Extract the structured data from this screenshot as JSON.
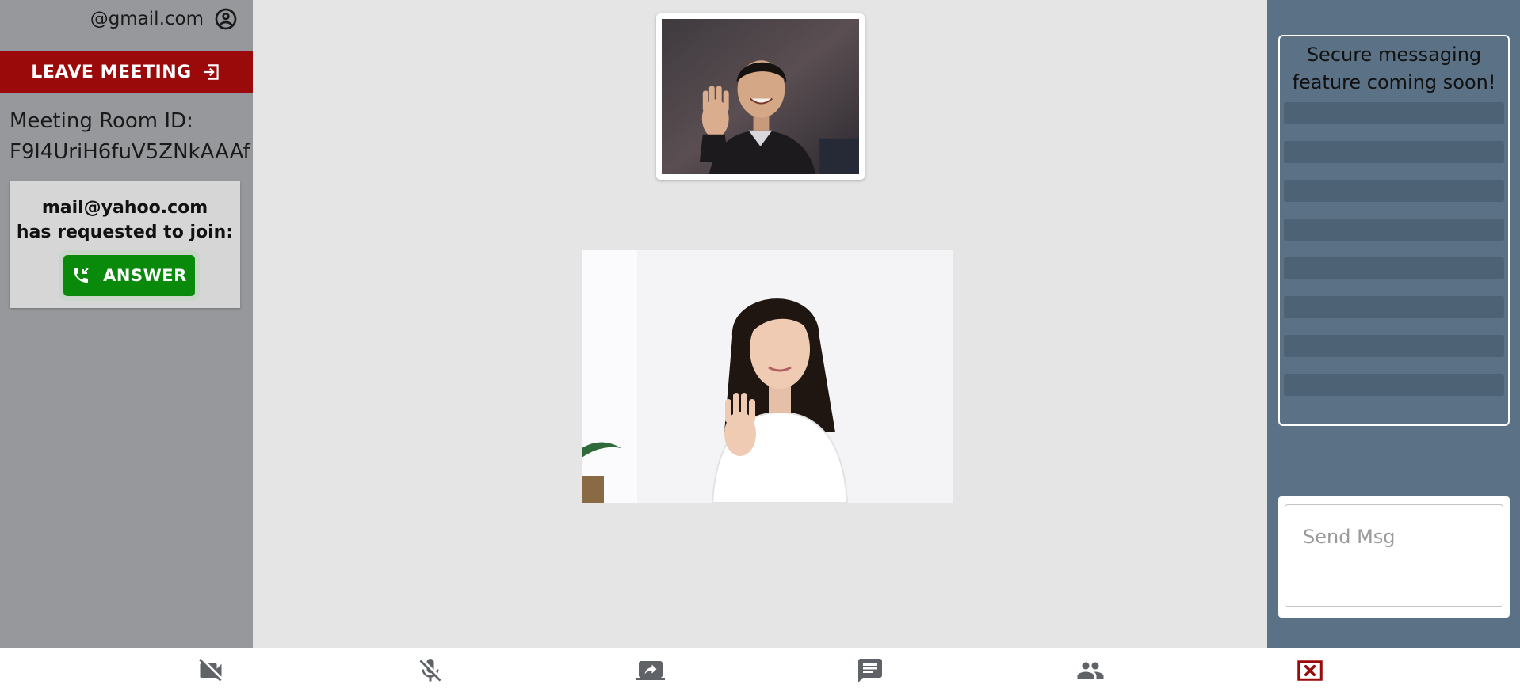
{
  "account": {
    "email": "@gmail.com",
    "icon": "account-circle-icon"
  },
  "meeting": {
    "leave_label": "LEAVE MEETING",
    "leave_icon": "exit-icon",
    "room_label": "Meeting Room ID:",
    "room_id": "F9l4UriH6fuV5ZNkAAAf"
  },
  "join_request": {
    "email": "mail@yahoo.com",
    "message": "has requested to join:",
    "answer_label": "ANSWER",
    "answer_icon": "phone-incoming-icon"
  },
  "chat": {
    "notice": "Secure messaging feature coming soon!",
    "placeholder": "Send Msg"
  },
  "toolbar": {
    "items": [
      {
        "name": "camera-off-button",
        "icon": "videocam-off-icon"
      },
      {
        "name": "mic-off-button",
        "icon": "mic-off-icon"
      },
      {
        "name": "share-screen-button",
        "icon": "screen-share-icon"
      },
      {
        "name": "chat-button",
        "icon": "chat-icon"
      },
      {
        "name": "participants-button",
        "icon": "people-icon"
      },
      {
        "name": "end-call-button",
        "icon": "close-box-icon"
      }
    ]
  },
  "colors": {
    "leave": "#9b0a0a",
    "answer": "#0a8a0a",
    "sidebar": "#96989b",
    "chat_panel": "#5b7185",
    "icon_gray": "#5f6368",
    "end_call": "#9b0a0a"
  }
}
